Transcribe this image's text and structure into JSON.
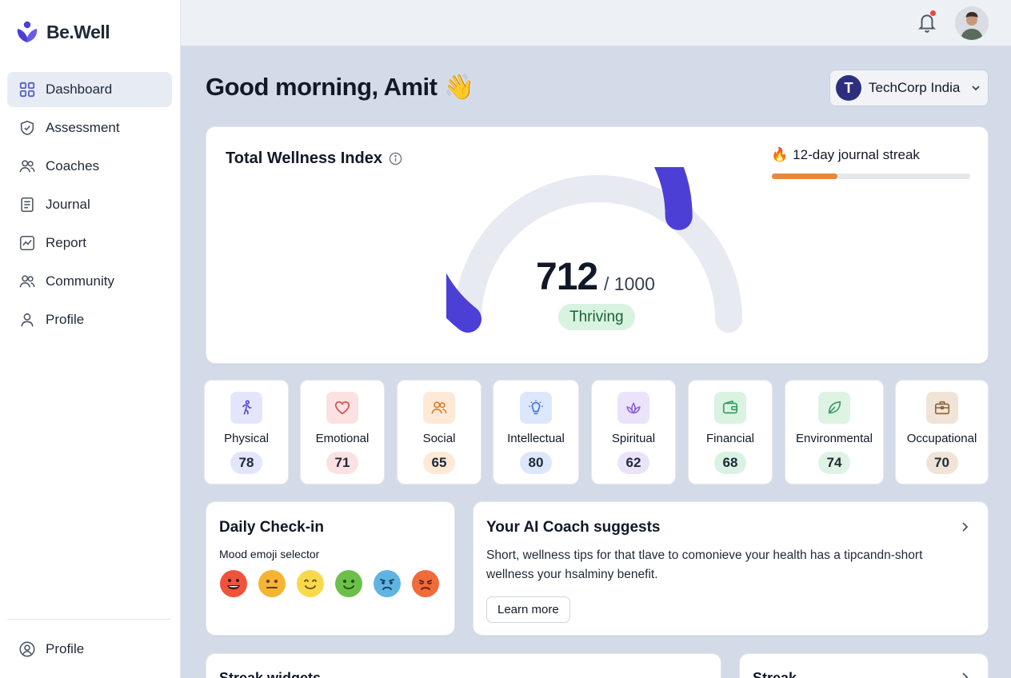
{
  "brand": {
    "name": "Be.Well",
    "accent": "#4b3fd6"
  },
  "sidebar": {
    "items": [
      {
        "label": "Dashboard",
        "icon": "grid-icon",
        "active": true
      },
      {
        "label": "Assessment",
        "icon": "shield-check-icon"
      },
      {
        "label": "Coaches",
        "icon": "users-icon"
      },
      {
        "label": "Journal",
        "icon": "document-icon"
      },
      {
        "label": "Report",
        "icon": "chart-line-icon"
      },
      {
        "label": "Community",
        "icon": "users-icon"
      },
      {
        "label": "Profile",
        "icon": "user-icon"
      }
    ],
    "bottom": {
      "label": "Profile",
      "icon": "user-circle-icon"
    }
  },
  "topbar": {
    "notification_icon": "bell-icon",
    "has_unread": true,
    "avatar": "user-avatar"
  },
  "greeting": {
    "text": "Good morning, Amit 👋"
  },
  "org": {
    "initial": "T",
    "name": "TechCorp India",
    "logo_color": "#2d2f7c"
  },
  "wellness": {
    "title": "Total Wellness Index",
    "score": "712",
    "max": "/ 1000",
    "score_value": 712,
    "score_max_value": 1000,
    "status": "Thriving",
    "gauge_color": "#4b3fd6",
    "gauge_track": "#e8eaf2"
  },
  "streak": {
    "emoji": "🔥",
    "label": "12-day journal streak",
    "progress": 0.33,
    "color": "#e8883a"
  },
  "dimensions": [
    {
      "label": "Physical",
      "score": "78",
      "icon": "running-icon",
      "color": "#e3e6fb",
      "icon_color": "#4b3fd6"
    },
    {
      "label": "Emotional",
      "score": "71",
      "icon": "heart-icon",
      "color": "#fbe1e1",
      "icon_color": "#dc4a4a"
    },
    {
      "label": "Social",
      "score": "65",
      "icon": "users-icon",
      "color": "#fde9d6",
      "icon_color": "#d97c2b"
    },
    {
      "label": "Intellectual",
      "score": "80",
      "icon": "lightbulb-icon",
      "color": "#dde7fb",
      "icon_color": "#3b6ed8"
    },
    {
      "label": "Spiritual",
      "score": "62",
      "icon": "lotus-icon",
      "color": "#ebe3fa",
      "icon_color": "#8b5cd6"
    },
    {
      "label": "Financial",
      "score": "68",
      "icon": "wallet-icon",
      "color": "#daf2e2",
      "icon_color": "#2f9a5a"
    },
    {
      "label": "Environmental",
      "score": "74",
      "icon": "leaf-icon",
      "color": "#def3e4",
      "icon_color": "#3a9a5e"
    },
    {
      "label": "Occupational",
      "score": "70",
      "icon": "briefcase-icon",
      "color": "#efe4d6",
      "icon_color": "#8a6238"
    }
  ],
  "checkin": {
    "title": "Daily Check-in",
    "subtitle": "Mood emoji selector",
    "moods": [
      {
        "name": "very-happy",
        "color": "#f0533a"
      },
      {
        "name": "neutral",
        "color": "#f5b533"
      },
      {
        "name": "content",
        "color": "#f8d94a"
      },
      {
        "name": "happy",
        "color": "#6cc04a"
      },
      {
        "name": "sad",
        "color": "#5fb4e2"
      },
      {
        "name": "upset",
        "color": "#f06a3a"
      }
    ]
  },
  "coach": {
    "title": "Your AI Coach suggests",
    "text": "Short, wellness tips for that tlave to comonieve your health has a tipcandn-short wellness your hsalminy benefit.",
    "button": "Learn more"
  },
  "bottom_cards": {
    "streak_widgets": "Streak widgets",
    "streak": "Streak"
  }
}
